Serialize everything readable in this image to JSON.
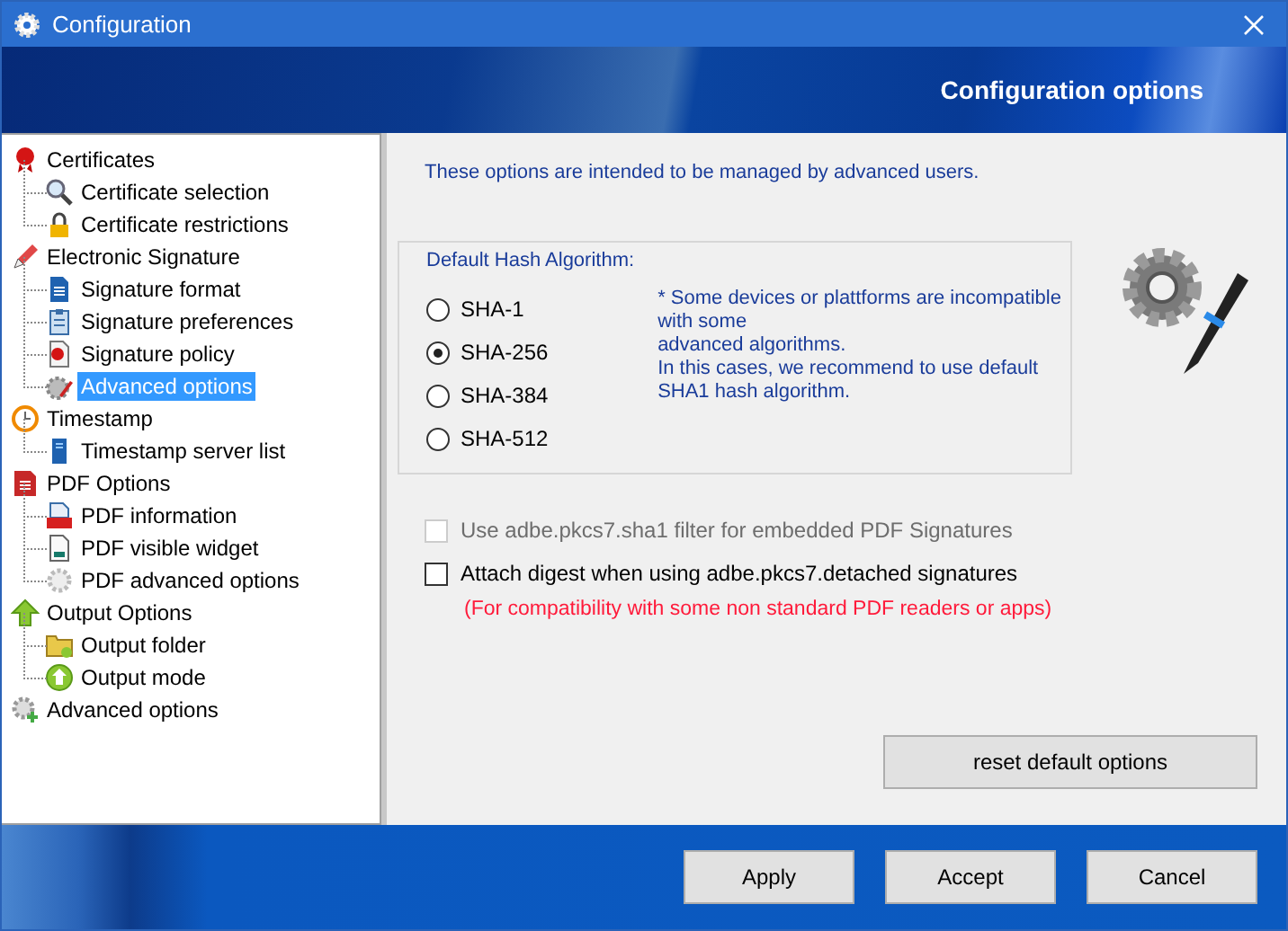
{
  "window": {
    "title": "Configuration"
  },
  "banner": {
    "title": "Configuration options"
  },
  "tree": [
    {
      "label": "Certificates",
      "kind": "seal",
      "selected": false,
      "children": [
        {
          "label": "Certificate selection",
          "kind": "magnifier",
          "selected": false
        },
        {
          "label": "Certificate restrictions",
          "kind": "lock",
          "selected": false
        }
      ]
    },
    {
      "label": "Electronic Signature",
      "kind": "pencil",
      "selected": false,
      "children": [
        {
          "label": "Signature format",
          "kind": "document",
          "selected": false
        },
        {
          "label": "Signature preferences",
          "kind": "clipboard",
          "selected": false
        },
        {
          "label": "Signature policy",
          "kind": "seal-page",
          "selected": false
        },
        {
          "label": "Advanced options",
          "kind": "gear-pencil",
          "selected": true
        }
      ]
    },
    {
      "label": "Timestamp",
      "kind": "clock",
      "selected": false,
      "children": [
        {
          "label": "Timestamp server list",
          "kind": "server",
          "selected": false
        }
      ]
    },
    {
      "label": "PDF Options",
      "kind": "pdf-doc",
      "selected": false,
      "children": [
        {
          "label": "PDF information",
          "kind": "pdf",
          "selected": false
        },
        {
          "label": "PDF visible widget",
          "kind": "page",
          "selected": false
        },
        {
          "label": "PDF advanced options",
          "kind": "gear",
          "selected": false
        }
      ]
    },
    {
      "label": "Output Options",
      "kind": "arrow",
      "selected": false,
      "children": [
        {
          "label": "Output folder",
          "kind": "folder",
          "selected": false
        },
        {
          "label": "Output mode",
          "kind": "circle-arrow",
          "selected": false
        }
      ]
    },
    {
      "label": "Advanced options",
      "kind": "gear-plus",
      "selected": false
    }
  ],
  "intro": "These options are intended to be managed by advanced users.",
  "hash_group": {
    "title": "Default Hash Algorithm:",
    "options": [
      {
        "label": "SHA-1",
        "selected": false
      },
      {
        "label": "SHA-256",
        "selected": true
      },
      {
        "label": "SHA-384",
        "selected": false
      },
      {
        "label": "SHA-512",
        "selected": false
      }
    ],
    "note": [
      "* Some devices or plattforms are incompatible with some",
      "advanced algorithms.",
      "In this cases, we recommend to use default SHA1 hash algorithm."
    ]
  },
  "checkboxes": [
    {
      "label": "Use adbe.pkcs7.sha1 filter for embedded PDF Signatures",
      "checked": false,
      "disabled": true
    },
    {
      "label": "Attach digest when using adbe.pkcs7.detached signatures",
      "checked": false,
      "disabled": false
    }
  ],
  "warning": "(For compatibility with some non standard PDF readers or apps)",
  "reset_button": "reset default options",
  "buttons": [
    "Apply",
    "Accept",
    "Cancel"
  ]
}
